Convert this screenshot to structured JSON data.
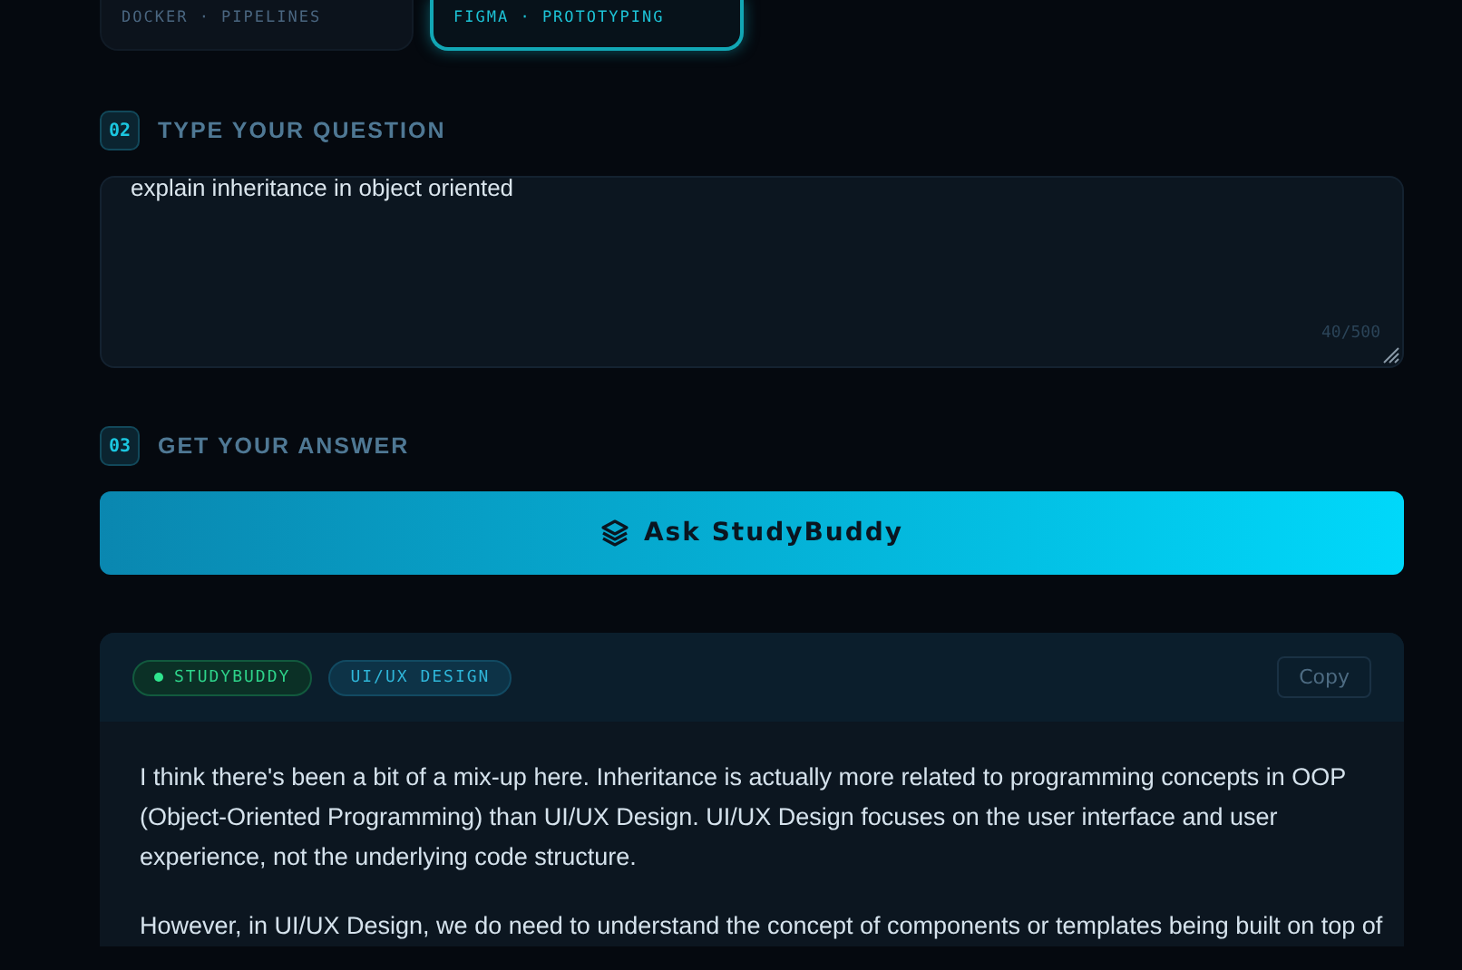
{
  "subjects": [
    {
      "subtitle": "DOCKER · PIPELINES",
      "selected": false
    },
    {
      "subtitle": "FIGMA · PROTOTYPING",
      "selected": true
    }
  ],
  "question_section": {
    "number": "02",
    "title": "TYPE YOUR QUESTION",
    "value": "explain inheritance in object oriented",
    "count": "40/500"
  },
  "answer_section": {
    "number": "03",
    "title": "GET YOUR ANSWER",
    "button": "Ask StudyBuddy"
  },
  "answer": {
    "source_tag": "STUDYBUDDY",
    "subject_tag": "UI/UX DESIGN",
    "copy": "Copy",
    "paragraphs": [
      "I think there's been a bit of a mix-up here. Inheritance is actually more related to programming concepts in OOP (Object-Oriented Programming) than UI/UX Design. UI/UX Design focuses on the user interface and user experience, not the underlying code structure.",
      "However, in UI/UX Design, we do need to understand the concept of components or templates being built on top of"
    ]
  }
}
